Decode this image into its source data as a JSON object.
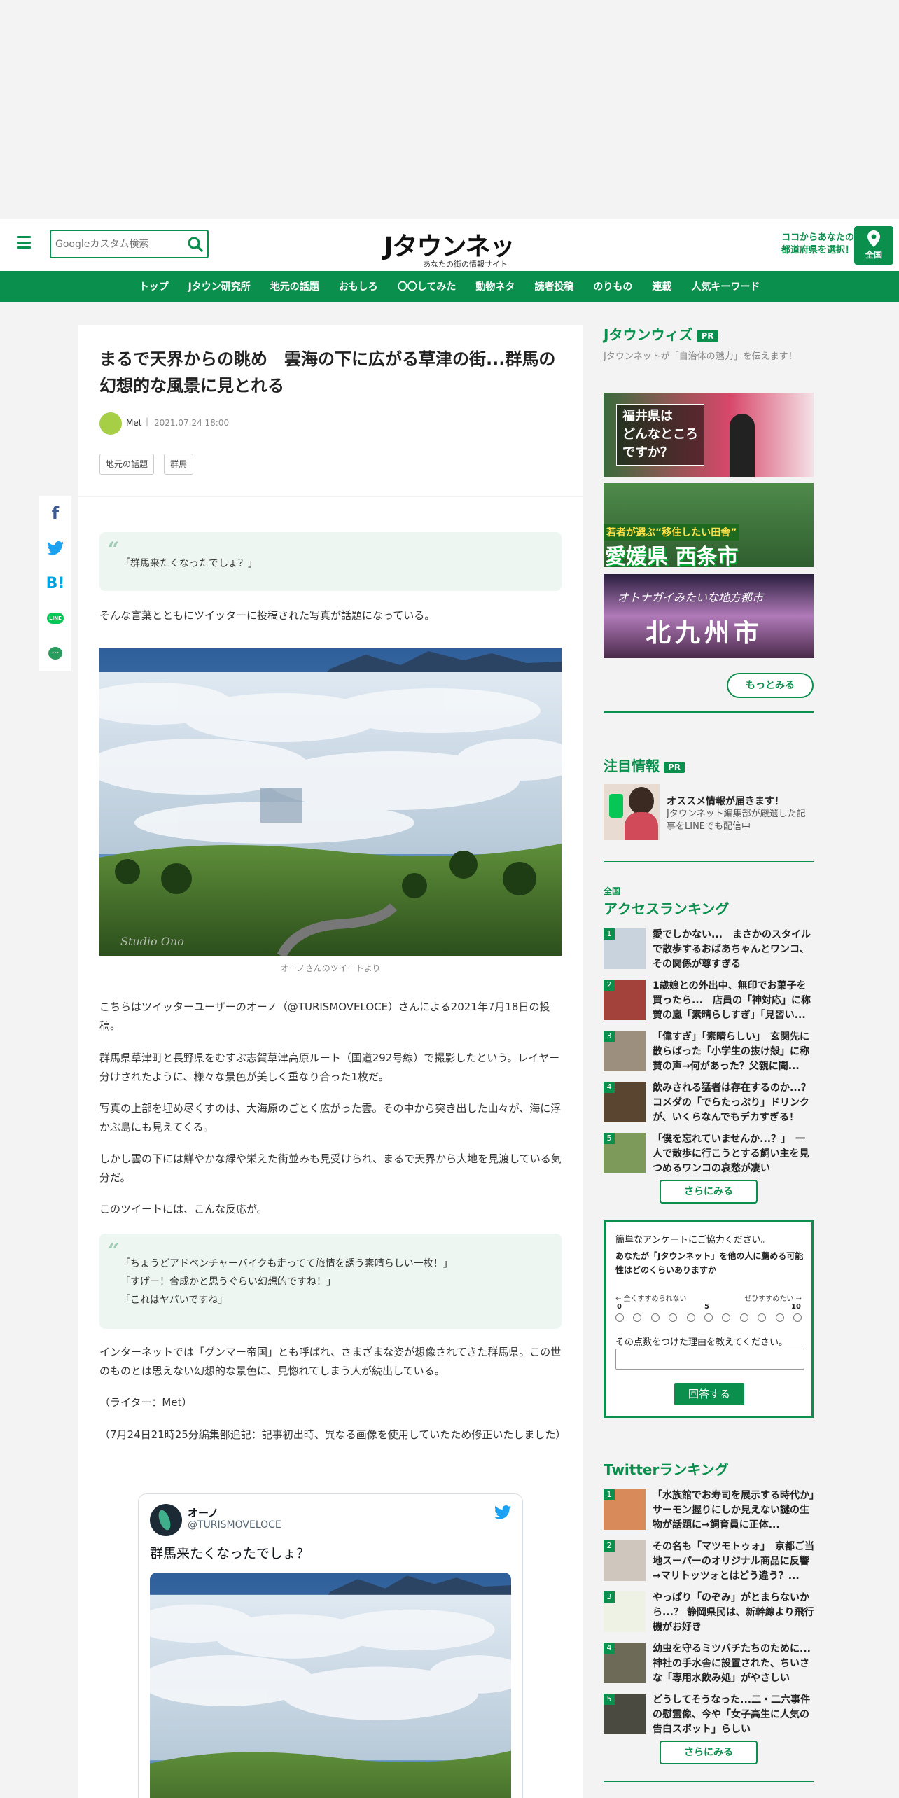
{
  "header": {
    "search_placeholder": "Googleカスタム検索",
    "logo_main": "Jタウンネット",
    "logo_sub": "あなたの街の情報サイト",
    "region_line1": "ココからあなたの",
    "region_line2": "都道府県を選択！",
    "region_button": "全国"
  },
  "nav": [
    "トップ",
    "Jタウン研究所",
    "地元の話題",
    "おもしろ",
    "〇〇してみた",
    "動物ネタ",
    "読者投稿",
    "のりもの",
    "連載",
    "人気キーワード"
  ],
  "social": [
    "f",
    "t",
    "B!",
    "LINE",
    "..."
  ],
  "article": {
    "title": "まるで天界からの眺め　雲海の下に広がる草津の街...群馬の幻想的な風景に見とれる",
    "author": "Met",
    "date": "2021.07.24 18:00",
    "tags": [
      "地元の話題",
      "群馬"
    ],
    "quote1": "「群馬来たくなったでしょ？」",
    "p1": "そんな言葉とともにツイッターに投稿された写真が話題になっている。",
    "photo_watermark": "Studio Ono",
    "caption": "オーノさんのツイートより",
    "p2": "こちらはツイッターユーザーのオーノ（@TURISMOVELOCE）さんによる2021年7月18日の投稿。",
    "p3": "群馬県草津町と長野県をむすぶ志賀草津高原ルート（国道292号線）で撮影したという。レイヤー分けされたように、様々な景色が美しく重なり合った1枚だ。",
    "p4": "写真の上部を埋め尽くすのは、大海原のごとく広がった雲。その中から突き出した山々が、海に浮かぶ島にも見えてくる。",
    "p5": "しかし雲の下には鮮やかな緑や栄えた街並みも見受けられ、まるで天界から大地を見渡している気分だ。",
    "p6": "このツイートには、こんな反応が。",
    "quote2": [
      "「ちょうどアドベンチャーバイクも走ってて旅情を誘う素晴らしい一枚！」",
      "「すげー！合成かと思うぐらい幻想的ですね！」",
      "「これはヤバいですね」"
    ],
    "p7": "インターネットでは「グンマー帝国」とも呼ばれ、さまざまな姿が想像されてきた群馬県。この世のものとは思えない幻想的な景色に、見惚れてしまう人が続出している。",
    "p8": "（ライター：Met）",
    "p9": "（7月24日21時25分編集部追記：記事初出時、異なる画像を使用していたため修正いたしました）"
  },
  "tweet": {
    "name": "オーノ",
    "handle": "@TURISMOVELOCE",
    "text": "群馬来たくなったでしょ？"
  },
  "sidebar": {
    "wiz_title": "Jタウンウィズ",
    "pr": "PR",
    "wiz_desc": "Jタウンネットが「自治体の魅力」を伝えます！",
    "banners": [
      {
        "text1": "福井県は",
        "text2": "どんなところ",
        "text3": "ですか？"
      },
      {
        "text1": "若者が選ぶ“移住したい田舎”",
        "text2": "愛媛県 西条市"
      },
      {
        "text1": "オトナガイみたいな地方都市",
        "text2": "北九州市"
      }
    ],
    "more": "もっとみる",
    "notice_title": "注目情報",
    "notice_head": "オススメ情報が届きます！",
    "notice_body": "Jタウンネット編集部が厳選した記事をLINEでも配信中",
    "access_area": "全国",
    "access_title": "アクセスランキング",
    "access_items": [
      {
        "num": "1",
        "text": "愛でしかない...　まさかのスタイルで散歩するおばあちゃんとワンコ、その関係が尊すぎる"
      },
      {
        "num": "2",
        "text": "1歳娘との外出中、無印でお菓子を買ったら...　店員の「神対応」に称賛の嵐「素晴らしすぎ」「見習い..."
      },
      {
        "num": "3",
        "text": "「偉すぎ」「素晴らしい」　玄関先に散らばった「小学生の抜け殻」に称賛の声→何があった？父親に聞..."
      },
      {
        "num": "4",
        "text": "飲みされる猛者は存在するのか...？　コメダの「でらたっぷり」ドリンクが、いくらなんでもデカすぎる！"
      },
      {
        "num": "5",
        "text": "「僕を忘れていませんか...？」　一人で散歩に行こうとする飼い主を見つめるワンコの哀愁が凄い"
      }
    ],
    "see_more": "さらにみる",
    "survey": {
      "intro": "簡単なアンケートにご協力ください。",
      "question": "あなたが「Jタウンネット」を他の人に薦める可能性はどのくらいありますか",
      "low": "← 全くすすめられない",
      "high": "ぜひすすめたい →",
      "n0": "0",
      "n5": "5",
      "n10": "10",
      "reason": "その点数をつけた理由を教えてください。",
      "submit": "回答する"
    },
    "twitter_title": "Twitterランキング",
    "twitter_items": [
      {
        "num": "1",
        "text": "「水族館でお寿司を展示する時代か」　サーモン握りにしか見えない謎の生物が話題に→飼育員に正体..."
      },
      {
        "num": "2",
        "text": "その名も「マツモトゥォ」　京都ご当地スーパーのオリジナル商品に反響→マリトッツォとはどう違う？..."
      },
      {
        "num": "3",
        "text": "やっぱり「のぞみ」がとまらないから...？ 静岡県民は、新幹線より飛行機がお好き"
      },
      {
        "num": "4",
        "text": "幼虫を守るミツバチたちのために...　神社の手水舎に設置された、ちいさな「専用水飲み処」がやさしい"
      },
      {
        "num": "5",
        "text": "どうしてそうなった...二・二六事件の慰霊像、今や「女子高生に人気の告白スポット」らしい"
      }
    ]
  }
}
